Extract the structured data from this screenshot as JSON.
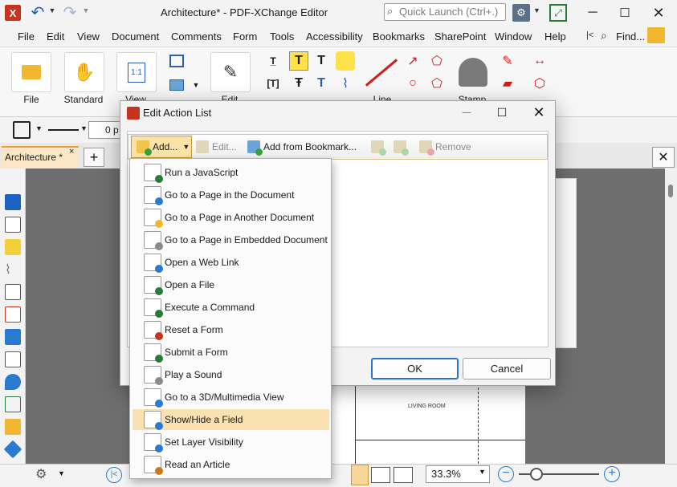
{
  "window": {
    "title": "Architecture* - PDF-XChange Editor",
    "quick_launch_placeholder": "Quick Launch (Ctrl+.)",
    "find_label": "Find..."
  },
  "menu": [
    "File",
    "Edit",
    "View",
    "Document",
    "Comments",
    "Form",
    "Tools",
    "Accessibility",
    "Bookmarks",
    "SharePoint",
    "Window",
    "Help"
  ],
  "ribbon": {
    "file_label": "File",
    "standard_label": "Standard",
    "view_label": "View",
    "edit_label": "Edit",
    "line_label": "Line",
    "stamp_label": "Stamp",
    "page_icon_text": "1:1"
  },
  "props": {
    "width_value": "0 p"
  },
  "tabs": [
    {
      "label": "Architecture *",
      "close": "×"
    }
  ],
  "new_tab_symbol": "+",
  "document": {
    "living_room": "LIVING ROOM"
  },
  "status": {
    "zoom": "33.3%"
  },
  "dialog": {
    "title": "Edit Action List",
    "toolbar": {
      "add": "Add...",
      "edit": "Edit...",
      "add_from_bookmark": "Add from Bookmark...",
      "remove": "Remove"
    },
    "ok": "OK",
    "cancel": "Cancel"
  },
  "add_menu": {
    "items": [
      {
        "label": "Run a JavaScript",
        "icon": "javascript-icon"
      },
      {
        "label": "Go to a Page in the Document",
        "icon": "goto-page-icon"
      },
      {
        "label": "Go to a Page in Another Document",
        "icon": "goto-other-doc-icon"
      },
      {
        "label": "Go to a Page in Embedded Document",
        "icon": "goto-embedded-doc-icon"
      },
      {
        "label": "Open a Web Link",
        "icon": "web-link-icon"
      },
      {
        "label": "Open a File",
        "icon": "open-file-icon"
      },
      {
        "label": "Execute a Command",
        "icon": "execute-command-icon"
      },
      {
        "label": "Reset a Form",
        "icon": "reset-form-icon"
      },
      {
        "label": "Submit a Form",
        "icon": "submit-form-icon"
      },
      {
        "label": "Play a Sound",
        "icon": "sound-icon"
      },
      {
        "label": "Go to a 3D/Multimedia View",
        "icon": "3d-view-icon"
      },
      {
        "label": "Show/Hide a Field",
        "icon": "show-hide-field-icon",
        "highlighted": true
      },
      {
        "label": "Set Layer Visibility",
        "icon": "layer-visibility-icon"
      },
      {
        "label": "Read an Article",
        "icon": "article-icon"
      }
    ]
  },
  "colors": {
    "accent": "#c8331f",
    "highlight": "#fae2b0",
    "primary_button_border": "#2b72d1"
  }
}
